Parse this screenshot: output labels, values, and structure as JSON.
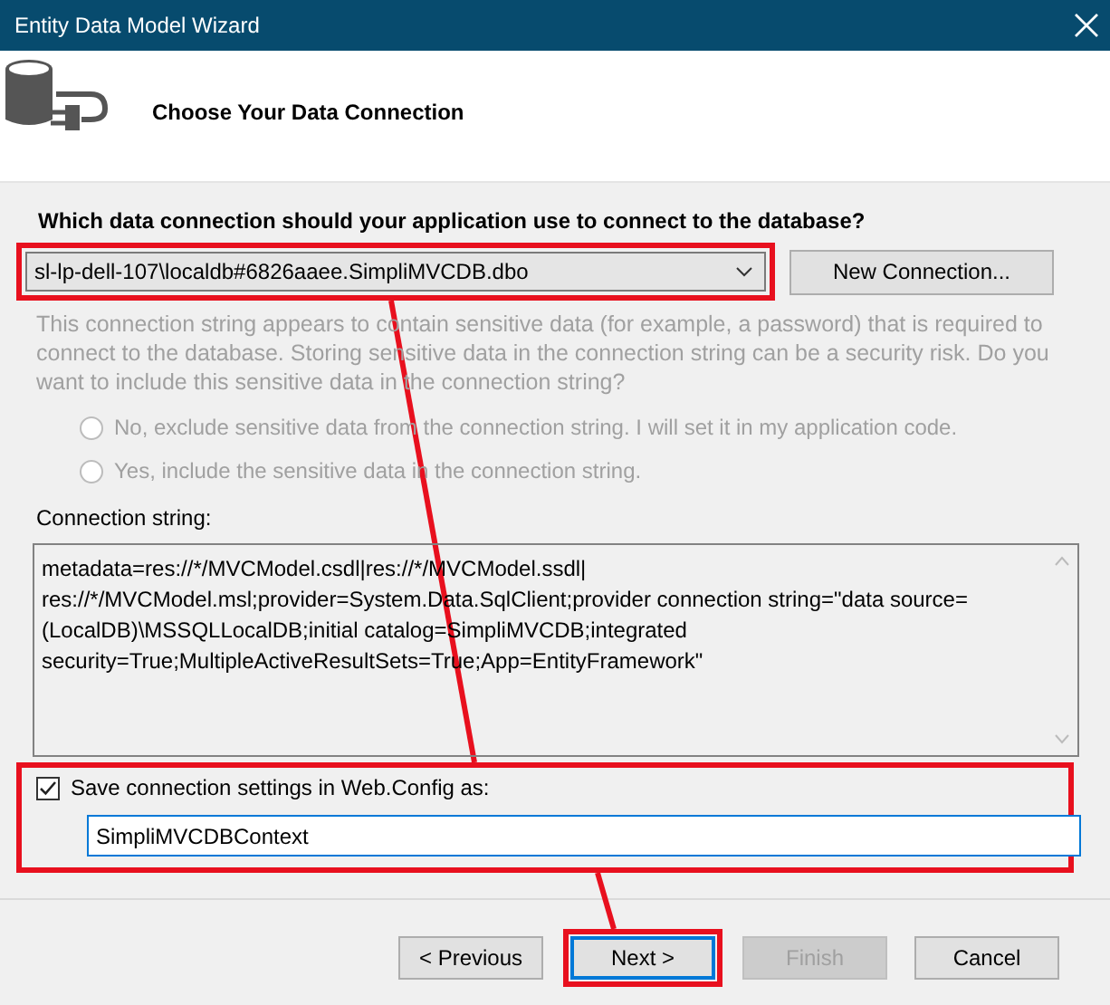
{
  "window": {
    "title": "Entity Data Model Wizard"
  },
  "header": {
    "title": "Choose Your Data Connection"
  },
  "connection": {
    "question": "Which data connection should your application use to connect to the database?",
    "selected_connection": "sl-lp-dell-107\\localdb#6826aaee.SimpliMVCDB.dbo",
    "highlighted": true,
    "new_connection_button": "New Connection..."
  },
  "sensitive": {
    "text": "This connection string appears to contain sensitive data (for example, a password) that is required to connect to the database. Storing sensitive data in the connection string can be a security risk. Do you want to include this sensitive data in the connection string?",
    "disabled": true,
    "options": [
      {
        "label": "No, exclude sensitive data from the connection string. I will set it in my application code.",
        "selected": false,
        "disabled": true
      },
      {
        "label": "Yes, include the sensitive data in the connection string.",
        "selected": false,
        "disabled": true
      }
    ]
  },
  "connection_string": {
    "label": "Connection string:",
    "value": "metadata=res://*/MVCModel.csdl|res://*/MVCModel.ssdl|\nres://*/MVCModel.msl;provider=System.Data.SqlClient;provider connection string=\"data source=\n(LocalDB)\\MSSQLLocalDB;initial catalog=SimpliMVCDB;integrated\nsecurity=True;MultipleActiveResultSets=True;App=EntityFramework\""
  },
  "save_settings": {
    "label": "Save connection settings in Web.Config as:",
    "checked": true,
    "value": "SimpliMVCDBContext",
    "highlighted": true
  },
  "buttons": [
    {
      "label": "< Previous",
      "disabled": false,
      "default": false,
      "highlighted": false
    },
    {
      "label": "Next >",
      "disabled": false,
      "default": true,
      "highlighted": true
    },
    {
      "label": "Finish",
      "disabled": true,
      "default": false,
      "highlighted": false
    },
    {
      "label": "Cancel",
      "disabled": false,
      "default": false,
      "highlighted": false
    }
  ]
}
